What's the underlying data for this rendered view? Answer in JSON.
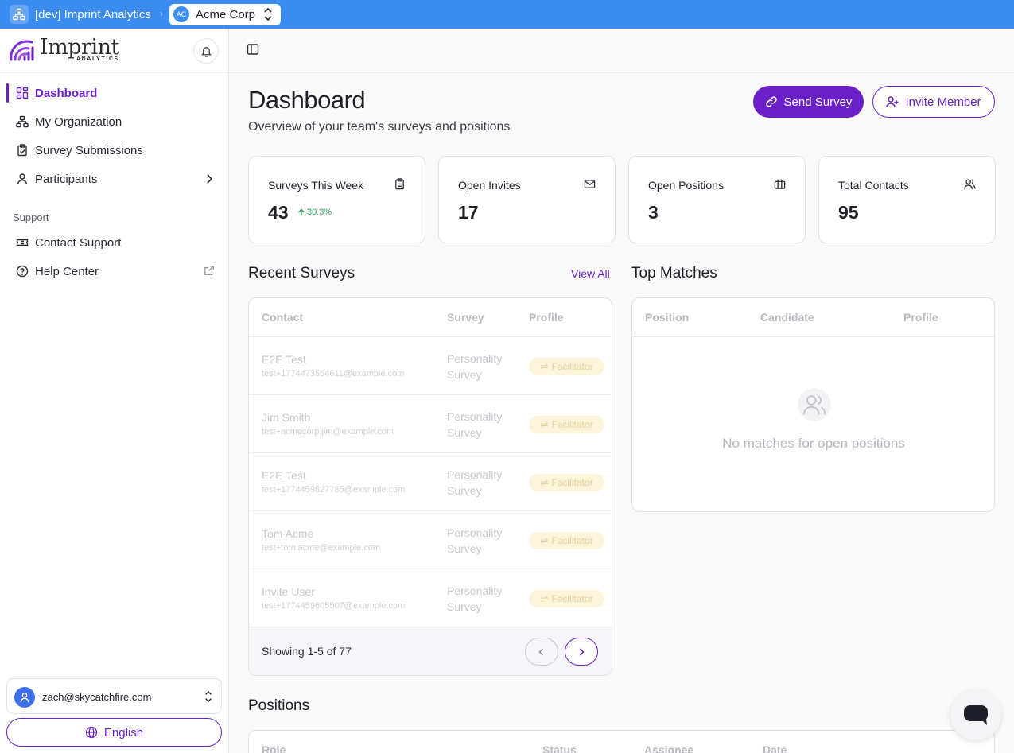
{
  "topbar": {
    "env_title": "[dev] Imprint Analytics",
    "org_initials": "AC",
    "org_name": "Acme Corp",
    "bg": "#3b8cf0"
  },
  "brand": {
    "name": "Imprint",
    "tagline": "ANALYTICS"
  },
  "nav": {
    "items": [
      {
        "label": "Dashboard",
        "icon": "layout-grid-icon",
        "active": true
      },
      {
        "label": "My Organization",
        "icon": "org-tree-icon"
      },
      {
        "label": "Survey Submissions",
        "icon": "clipboard-check-icon"
      },
      {
        "label": "Participants",
        "icon": "user-icon"
      }
    ],
    "support_header": "Support",
    "support_items": [
      {
        "label": "Contact Support",
        "icon": "ticket-icon"
      },
      {
        "label": "Help Center",
        "icon": "help-circle-icon"
      }
    ]
  },
  "user": {
    "email": "zach@skycatchfire.com",
    "language": "English"
  },
  "page": {
    "title": "Dashboard",
    "subtitle": "Overview of your team's surveys and positions",
    "send_survey": "Send Survey",
    "invite_member": "Invite Member"
  },
  "stats": [
    {
      "label": "Surveys This Week",
      "value": "43",
      "trend": "30.3%",
      "icon": "clipboard-icon"
    },
    {
      "label": "Open Invites",
      "value": "17",
      "icon": "mail-icon"
    },
    {
      "label": "Open Positions",
      "value": "3",
      "icon": "briefcase-icon"
    },
    {
      "label": "Total Contacts",
      "value": "95",
      "icon": "users-icon"
    }
  ],
  "recent": {
    "title": "Recent Surveys",
    "view_all": "View All",
    "columns": [
      "Contact",
      "Survey",
      "Profile"
    ],
    "rows": [
      {
        "name": "E2E Test",
        "email": "test+1774473554611@example.com",
        "survey": "Personality Survey",
        "profile": "Facilitator"
      },
      {
        "name": "Jim Smith",
        "email": "test+acmecorp.jim@example.com",
        "survey": "Personality Survey",
        "profile": "Facilitator"
      },
      {
        "name": "E2E Test",
        "email": "test+1774459827785@example.com",
        "survey": "Personality Survey",
        "profile": "Facilitator"
      },
      {
        "name": "Tom Acme",
        "email": "test+tom.acme@example.com",
        "survey": "Personality Survey",
        "profile": "Facilitator"
      },
      {
        "name": "Invite User",
        "email": "test+1774459605507@example.com",
        "survey": "Personality Survey",
        "profile": "Facilitator"
      }
    ],
    "footer": "Showing 1-5 of 77"
  },
  "top_matches": {
    "title": "Top Matches",
    "columns": [
      "Position",
      "Candidate",
      "Profile"
    ],
    "empty": "No matches for open positions"
  },
  "positions": {
    "title": "Positions",
    "columns": [
      "Role",
      "Status",
      "Assignee",
      "Date"
    ]
  },
  "colors": {
    "accent": "#6a1fc9",
    "success": "#2f9e5a"
  }
}
